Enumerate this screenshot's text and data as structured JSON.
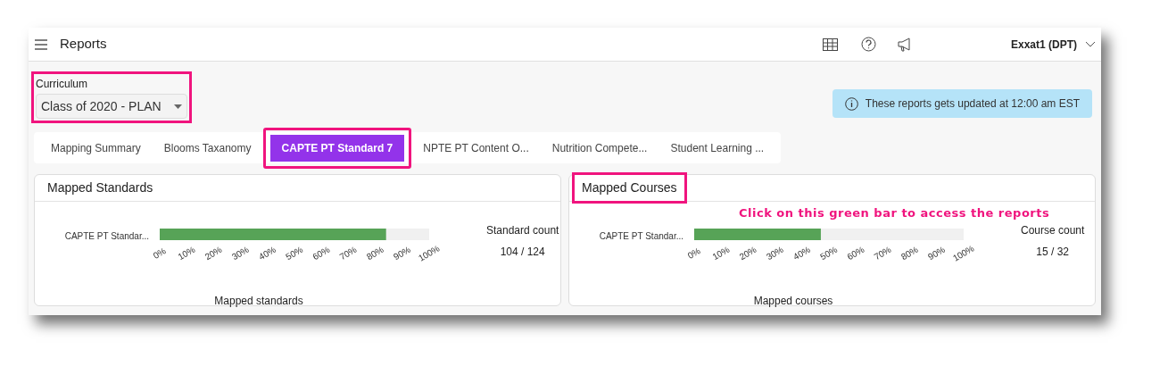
{
  "header": {
    "title": "Reports",
    "user": "Exxat1 (DPT)"
  },
  "curriculum": {
    "label": "Curriculum",
    "value": "Class of 2020 - PLAN",
    "highlighted": true
  },
  "notice": "These reports gets updated at 12:00 am EST",
  "tabs": [
    {
      "label": "Mapping Summary",
      "selected": false,
      "highlighted": false
    },
    {
      "label": "Blooms Taxanomy",
      "selected": false,
      "highlighted": false
    },
    {
      "label": "CAPTE PT Standard 7",
      "selected": true,
      "highlighted": true
    },
    {
      "label": "NPTE PT Content O...",
      "selected": false,
      "highlighted": false
    },
    {
      "label": "Nutrition Compete...",
      "selected": false,
      "highlighted": false
    },
    {
      "label": "Student Learning ...",
      "selected": false,
      "highlighted": false
    }
  ],
  "panels": [
    {
      "title": "Mapped Standards",
      "highlighted": false,
      "count_label": "Standard count",
      "count": "104 / 124",
      "chart_data": {
        "type": "bar",
        "orientation": "horizontal",
        "categories": [
          "CAPTE PT Standar..."
        ],
        "values": [
          84
        ],
        "xlabel": "Mapped standards",
        "xlim": [
          0,
          100
        ],
        "xticks": [
          {
            "value": 0,
            "label": "0%"
          },
          {
            "value": 10,
            "label": "10%"
          },
          {
            "value": 20,
            "label": "20%"
          },
          {
            "value": 30,
            "label": "30%"
          },
          {
            "value": 40,
            "label": "40%"
          },
          {
            "value": 50,
            "label": "50%"
          },
          {
            "value": 60,
            "label": "60%"
          },
          {
            "value": 70,
            "label": "70%"
          },
          {
            "value": 80,
            "label": "80%"
          },
          {
            "value": 90,
            "label": "90%"
          },
          {
            "value": 100,
            "label": "100%"
          }
        ]
      }
    },
    {
      "title": "Mapped Courses",
      "highlighted": true,
      "annotation": "Click on this green bar to access the reports",
      "count_label": "Course count",
      "count": "15 / 32",
      "chart_data": {
        "type": "bar",
        "orientation": "horizontal",
        "categories": [
          "CAPTE PT Standar..."
        ],
        "values": [
          47
        ],
        "xlabel": "Mapped courses",
        "xlim": [
          0,
          100
        ],
        "xticks": [
          {
            "value": 0,
            "label": "0%"
          },
          {
            "value": 10,
            "label": "10%"
          },
          {
            "value": 20,
            "label": "20%"
          },
          {
            "value": 30,
            "label": "30%"
          },
          {
            "value": 40,
            "label": "40%"
          },
          {
            "value": 50,
            "label": "50%"
          },
          {
            "value": 60,
            "label": "60%"
          },
          {
            "value": 70,
            "label": "70%"
          },
          {
            "value": 80,
            "label": "80%"
          },
          {
            "value": 90,
            "label": "90%"
          },
          {
            "value": 100,
            "label": "100%"
          }
        ]
      }
    }
  ]
}
